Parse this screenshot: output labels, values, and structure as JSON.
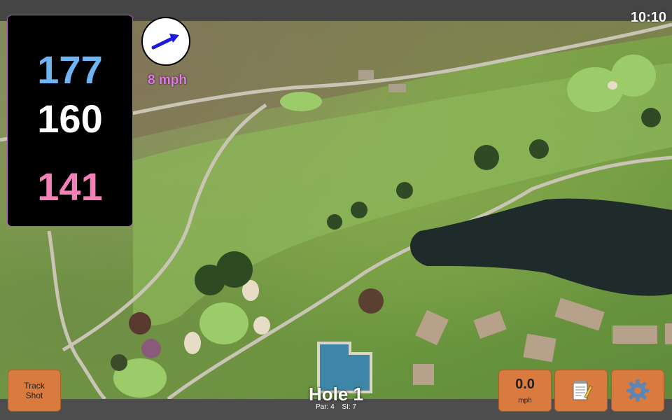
{
  "status": {
    "time": "10:10"
  },
  "yardage": {
    "back": "177",
    "middle": "160",
    "front": "141"
  },
  "wind": {
    "speed": "8 mph",
    "direction_icon": "arrow-right-icon"
  },
  "hole": {
    "title": "Hole 1",
    "par": "Par: 4",
    "stroke_index": "SI: 7"
  },
  "buttons": {
    "track_shot": "Track\nShot",
    "wind_value": "0.0",
    "wind_unit": "mph",
    "notes_icon": "notepad-icon",
    "settings_icon": "gear-icon"
  },
  "colors": {
    "back_yardage": "#6fb4f3",
    "middle_yardage": "#ffffff",
    "front_yardage": "#f580b8",
    "button": "#d97a3e",
    "wind_label": "#e07ae8"
  }
}
